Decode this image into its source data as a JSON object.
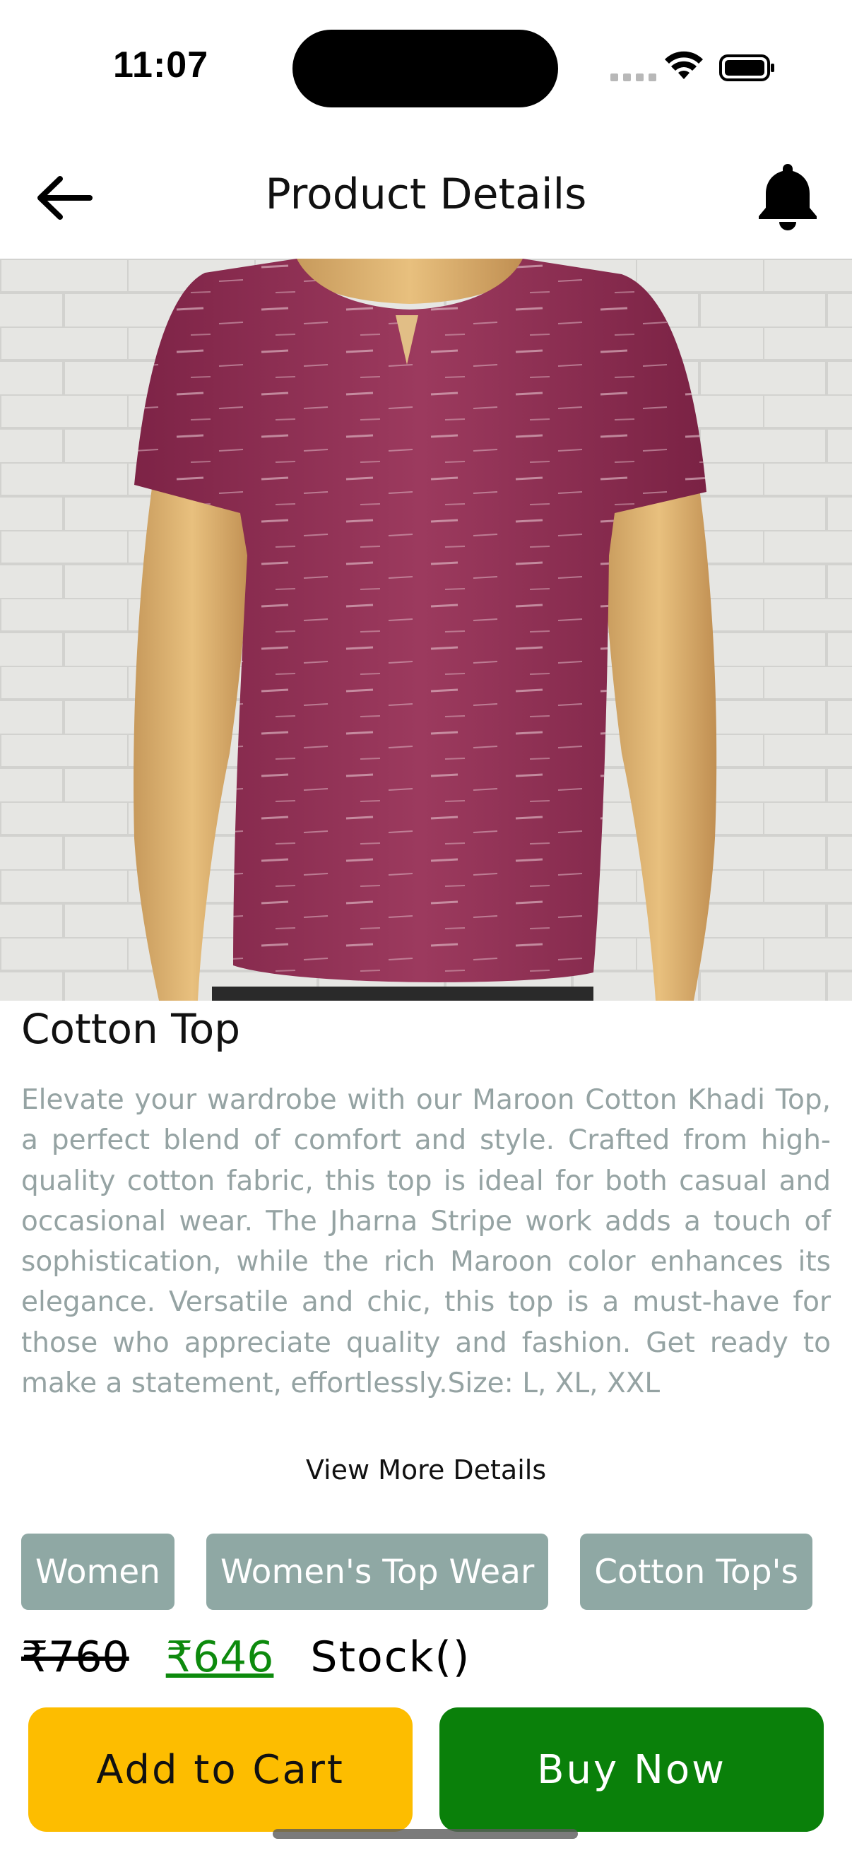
{
  "status_bar": {
    "time": "11:07"
  },
  "header": {
    "title": "Product Details",
    "back_icon": "arrow-left-icon",
    "notification_icon": "bell-icon"
  },
  "product": {
    "image_icon": "product-photo",
    "name": "Cotton Top",
    "description": "Elevate your wardrobe with our Maroon Cotton Khadi Top, a perfect blend of comfort and style. Crafted from high-quality cotton fabric, this top is ideal for both casual and occasional wear. The Jharna Stripe work adds a touch of sophistication, while the rich Maroon color enhances its elegance. Versatile and chic, this top is a must-have for those who appreciate quality and fashion. Get ready to make a statement, effortlessly.Size: L, XL, XXL",
    "view_more_label": "View More Details",
    "tags": [
      "Women",
      "Women's Top Wear",
      "Cotton Top's"
    ],
    "old_price": "₹760",
    "new_price": "₹646",
    "stock_label": "Stock()"
  },
  "actions": {
    "add_to_cart_label": "Add to Cart",
    "buy_now_label": "Buy Now"
  },
  "colors": {
    "cart_button": "#fdbd00",
    "buy_button": "#0a800a",
    "tag_background": "#8fa8a4",
    "description_text": "#95a3a3",
    "price_accent": "#0d8a0d"
  }
}
